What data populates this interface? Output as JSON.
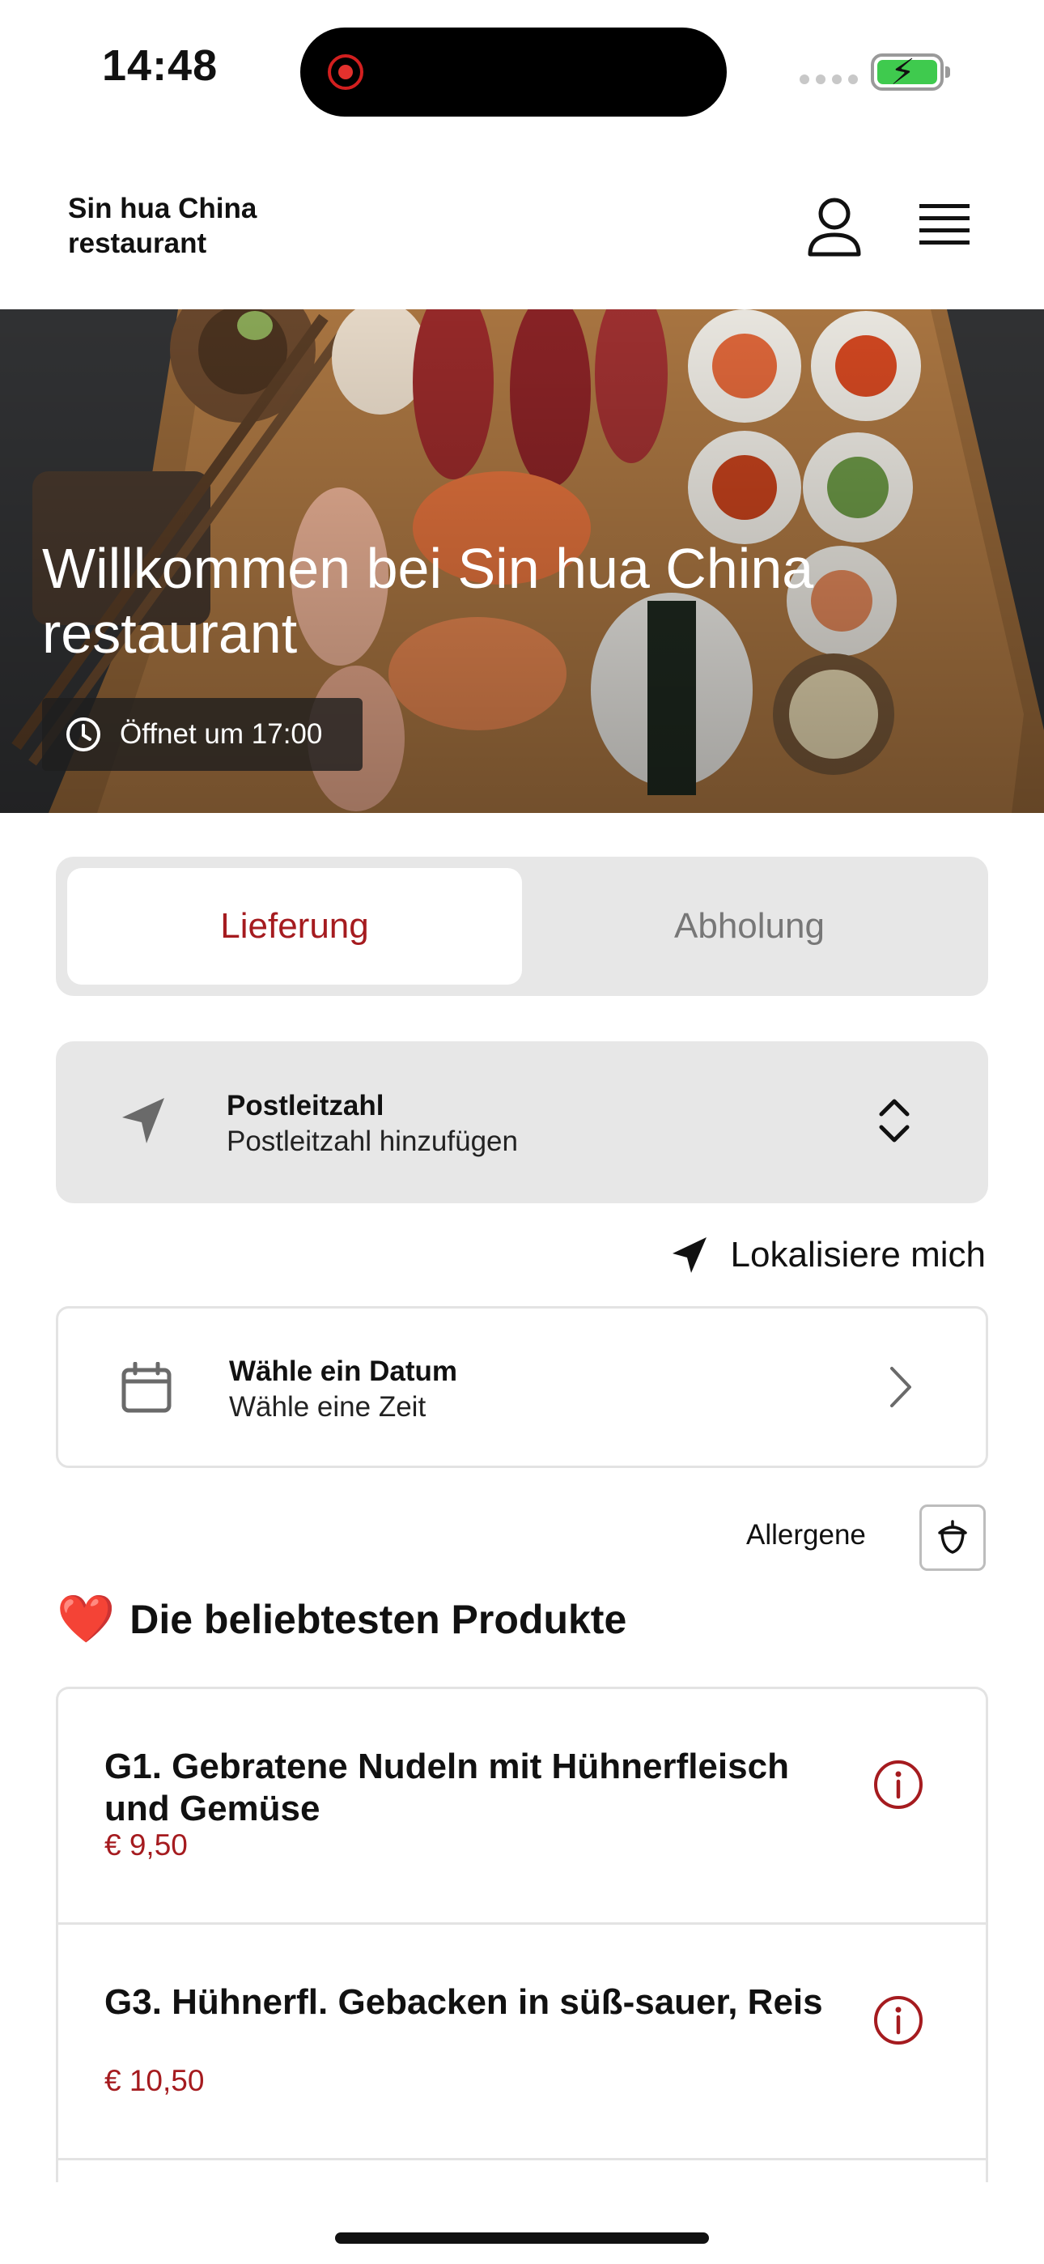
{
  "status_bar": {
    "time": "14:48"
  },
  "header": {
    "brand_name": "Sin hua China restaurant",
    "user_icon": "user-icon",
    "menu_icon": "hamburger-menu-icon"
  },
  "hero": {
    "title": "Willkommen bei Sin hua China restaurant",
    "opening_badge": "Öffnet um 17:00"
  },
  "order_mode": {
    "tabs": [
      {
        "label": "Lieferung",
        "selected": true
      },
      {
        "label": "Abholung",
        "selected": false
      }
    ],
    "accent_color": "#a51b1f"
  },
  "postcode": {
    "label": "Postleitzahl",
    "placeholder": "Postleitzahl hinzufügen"
  },
  "locate": {
    "label": "Lokalisiere mich"
  },
  "schedule": {
    "date_label": "Wähle ein Datum",
    "time_label": "Wähle eine Zeit"
  },
  "allergens": {
    "label": "Allergene"
  },
  "popular": {
    "title": "Die beliebtesten Produkte",
    "emoji": "❤️",
    "products": [
      {
        "name": "G1. Gebratene Nudeln mit Hühnerfleisch und Gemüse",
        "price": "€ 9,50"
      },
      {
        "name": "G3. Hühnerfl. Gebacken in süß-sauer, Reis",
        "price": "€ 10,50"
      }
    ]
  }
}
